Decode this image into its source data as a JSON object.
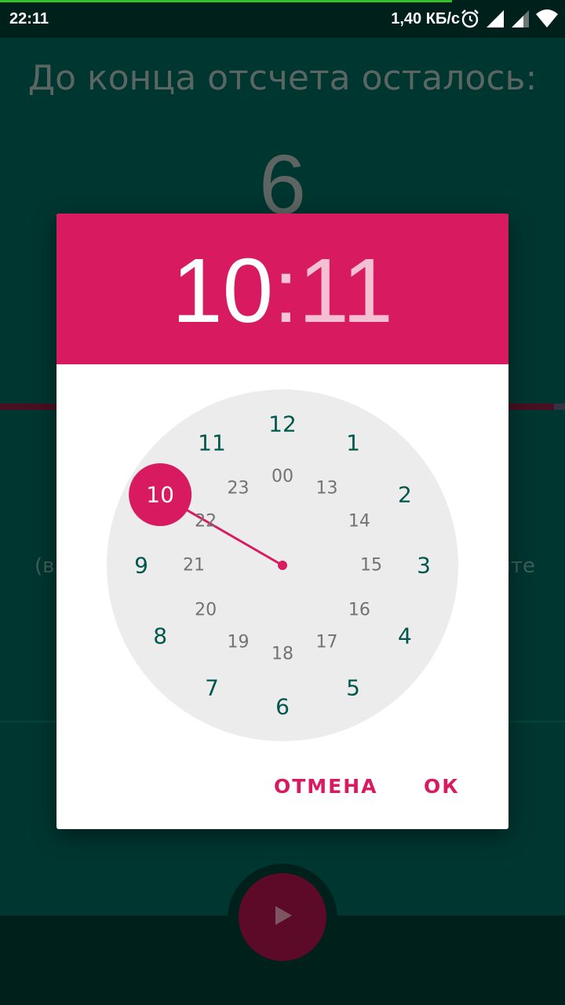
{
  "status_bar": {
    "time": "22:11",
    "net_speed": "1,40 КБ/с",
    "icons": [
      "alarm-icon",
      "signal-icon",
      "signal-2-icon",
      "wifi-icon"
    ],
    "progress_fraction": 0.8
  },
  "app": {
    "title": "До конца отсчета осталось:",
    "countdown_value": "6",
    "hint_left": "(в",
    "hint_right": "ите"
  },
  "dialog": {
    "hour": "10",
    "separator": ":",
    "minute": "11",
    "clock": {
      "selected": "10",
      "outer_numbers": [
        "12",
        "1",
        "2",
        "3",
        "4",
        "5",
        "6",
        "7",
        "8",
        "9",
        "10",
        "11"
      ],
      "inner_numbers": [
        "00",
        "13",
        "14",
        "15",
        "16",
        "17",
        "18",
        "19",
        "20",
        "21",
        "22",
        "23"
      ]
    },
    "cancel_label": "ОТМЕНА",
    "ok_label": "ОК"
  },
  "colors": {
    "accent": "#d81b60",
    "app_background": "#003630",
    "clock_face": "#ececec",
    "outer_number": "#00574b",
    "inner_number": "#727272"
  }
}
